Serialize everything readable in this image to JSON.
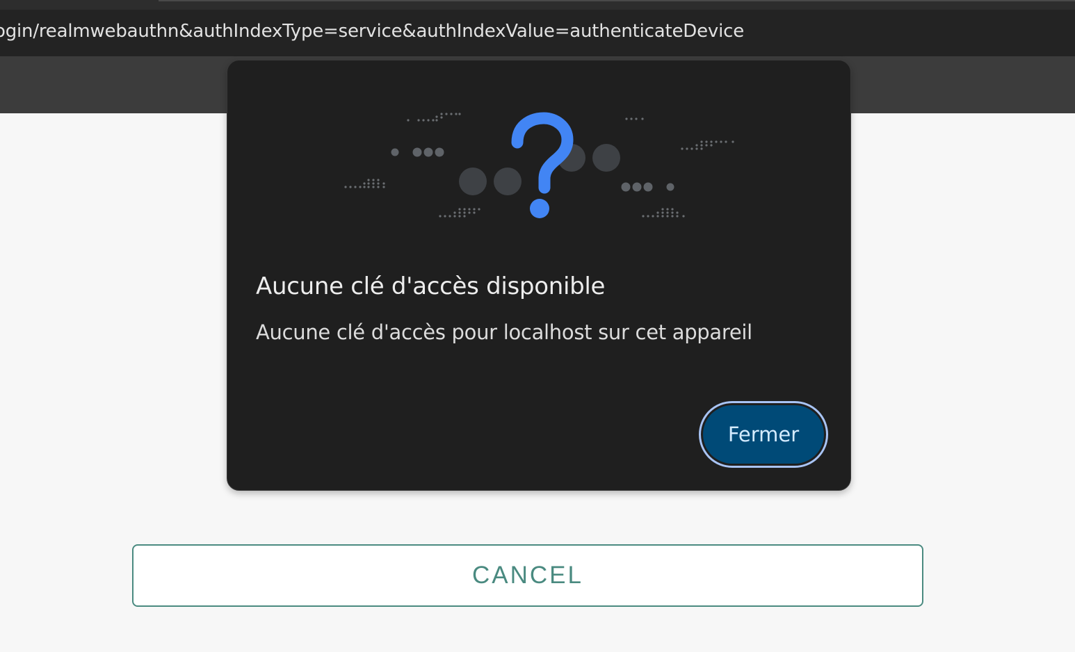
{
  "browser": {
    "url": "ogin/realmwebauthn&authIndexType=service&authIndexValue=authenticateDevice"
  },
  "dialog": {
    "illustration_icon": "question-mark-icon",
    "title": "Aucune clé d'accès disponible",
    "message": "Aucune clé d'accès pour localhost sur cet appareil",
    "close_label": "Fermer"
  },
  "page": {
    "cancel_label": "CANCEL"
  },
  "colors": {
    "dialog_background": "#1f1f1f",
    "accent_blue": "#4285f4",
    "close_button_fill": "#004a77",
    "close_button_ring": "#a8c4f5",
    "cancel_teal": "#4a8a80"
  }
}
